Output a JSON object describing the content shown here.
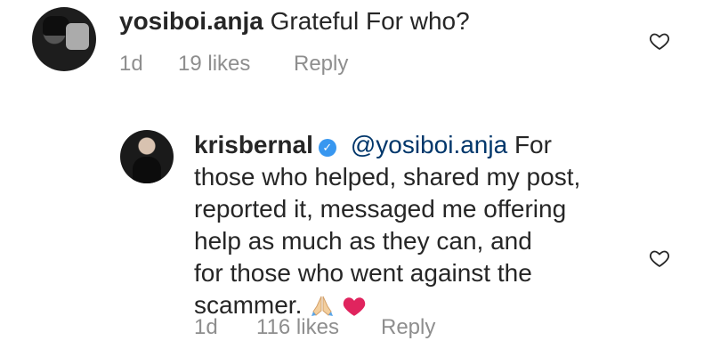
{
  "comments": [
    {
      "username": "yosiboi.anja",
      "text": "Grateful For who?",
      "time": "1d",
      "likes": "19 likes",
      "reply": "Reply"
    },
    {
      "username": "krisbernal",
      "verified": true,
      "mention": "@yosiboi.anja",
      "lines": [
        "For",
        "those who helped, shared my post,",
        "reported it, messaged me offering",
        "help as much as they can, and",
        "for those who went against the",
        "scammer."
      ],
      "emojis": [
        "folded-hands-emoji",
        "red-heart-emoji"
      ],
      "time": "1d",
      "likes": "116 likes",
      "reply": "Reply"
    }
  ],
  "colors": {
    "text": "#262626",
    "meta": "#8e8e8e",
    "mention": "#00376b",
    "verified": "#3897f0",
    "heart_emoji": "#e0245e"
  }
}
